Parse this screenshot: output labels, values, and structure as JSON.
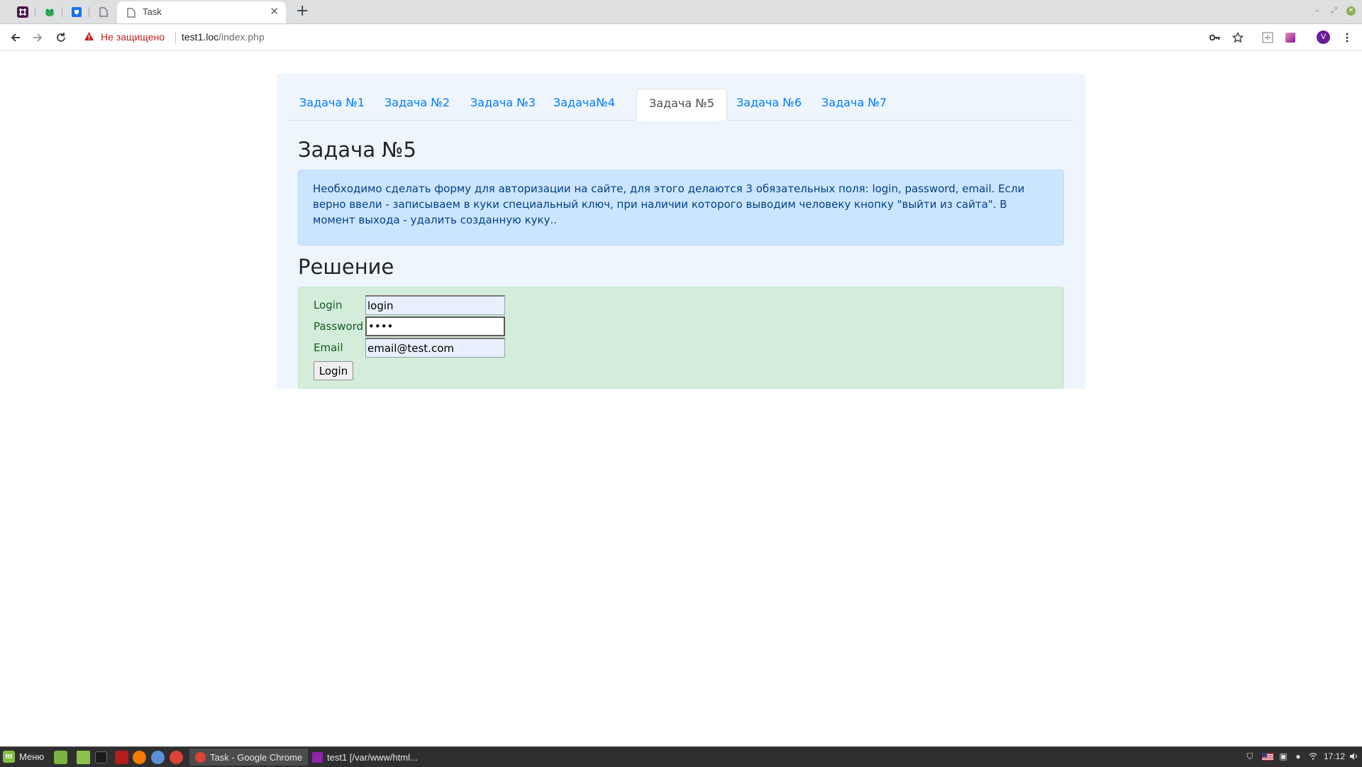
{
  "browser": {
    "tab_title": "Task",
    "tab_close": "✕",
    "new_tab": "+",
    "security_label": "Не защищено",
    "url_host": "test1.loc",
    "url_path": "/index.php",
    "avatar_letter": "V",
    "minimize": "–",
    "restore": "⤢",
    "close": "✕"
  },
  "nav": {
    "tabs": [
      {
        "label": "Задача №1"
      },
      {
        "label": "Задача №2"
      },
      {
        "label": "Задача №3"
      },
      {
        "label": "Задача№4"
      },
      {
        "label": "Задача №5"
      },
      {
        "label": "Задача №6"
      },
      {
        "label": "Задача №7"
      }
    ]
  },
  "task": {
    "title": "Задача №5",
    "description": "Необходимо сделать форму для авторизации на сайте, для этого делаются 3 обязательных поля: login, password, email. Если верно ввели - записываем в куки специальный ключ, при наличии которого выводим человеку кнопку \"выйти из сайта\". В момент выхода - удалить созданную куку..",
    "solution_title": "Решение"
  },
  "form": {
    "login_label": "Login",
    "login_value": "login",
    "password_label": "Password",
    "password_value": "abcd",
    "email_label": "Email",
    "email_value": "email@test.com",
    "submit_label": "Login"
  },
  "taskbar": {
    "menu_label": "Меню",
    "windows": [
      {
        "label": "Task - Google Chrome"
      },
      {
        "label": "test1 [/var/www/html..."
      }
    ],
    "clock": "17:12"
  },
  "colors": {
    "link": "#007bff",
    "info_bg": "#cce5ff",
    "success_bg": "#d4edda",
    "container_bg": "#eef5fd",
    "insecure": "#c5221f"
  }
}
